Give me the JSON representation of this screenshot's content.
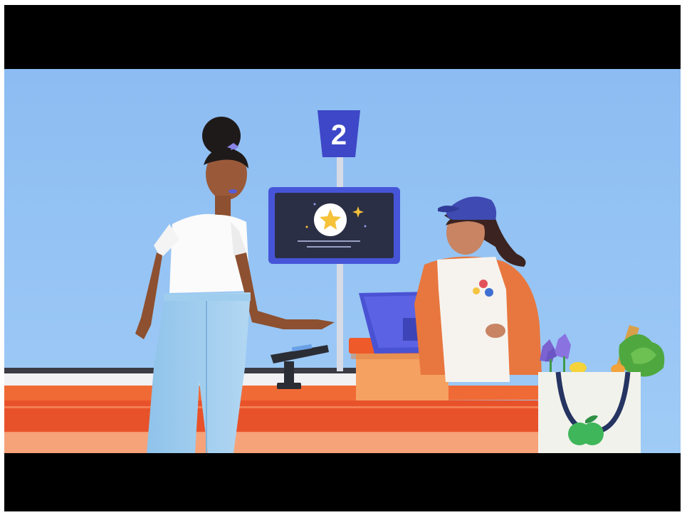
{
  "video_player": {
    "lane_sign": {
      "number": "2"
    },
    "colors": {
      "sky": "#8fc0f4",
      "counter": "#ef5a2a",
      "sign": "#3d47c8",
      "screen_frame": "#4655d8",
      "screen_face": "#2b2f45",
      "star": "#f5c23a",
      "bag": "#f2f2ec",
      "apple": "#3fb65a"
    },
    "icons": [
      "star-icon",
      "sparkle-icon",
      "apple-logo-icon"
    ]
  }
}
